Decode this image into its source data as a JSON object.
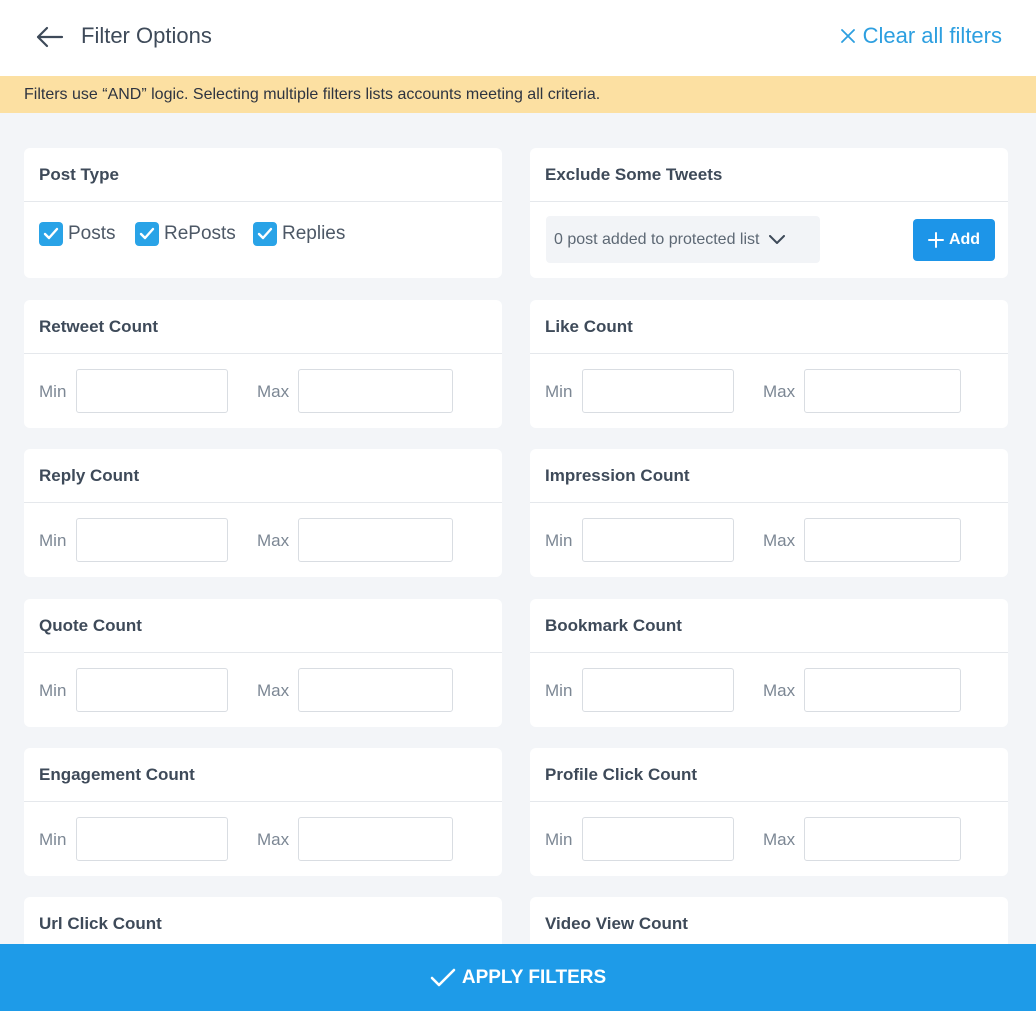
{
  "header": {
    "title": "Filter Options",
    "clear_label": "Clear all filters",
    "back_icon": "arrow-left-icon",
    "clear_icon": "close-icon"
  },
  "notice": "Filters use “AND” logic. Selecting multiple filters lists accounts meeting all criteria.",
  "post_type": {
    "title": "Post Type",
    "options": [
      {
        "label": "Posts",
        "checked": true
      },
      {
        "label": "RePosts",
        "checked": true
      },
      {
        "label": "Replies",
        "checked": true
      }
    ]
  },
  "exclude": {
    "title": "Exclude Some Tweets",
    "dropdown_label": "0 post added to protected list",
    "add_label": "Add"
  },
  "range_labels": {
    "min": "Min",
    "max": "Max"
  },
  "range_filters": [
    {
      "title": "Retweet Count",
      "min": "",
      "max": ""
    },
    {
      "title": "Like Count",
      "min": "",
      "max": ""
    },
    {
      "title": "Reply Count",
      "min": "",
      "max": ""
    },
    {
      "title": "Impression Count",
      "min": "",
      "max": ""
    },
    {
      "title": "Quote Count",
      "min": "",
      "max": ""
    },
    {
      "title": "Bookmark Count",
      "min": "",
      "max": ""
    },
    {
      "title": "Engagement Count",
      "min": "",
      "max": ""
    },
    {
      "title": "Profile Click Count",
      "min": "",
      "max": ""
    },
    {
      "title": "Url Click Count",
      "min": "",
      "max": ""
    },
    {
      "title": "Video View Count",
      "min": "",
      "max": ""
    }
  ],
  "apply_label": "APPLY FILTERS",
  "colors": {
    "accent": "#1e9be8",
    "notice_bg": "#fce0a2",
    "checkbox": "#29a3e7"
  }
}
